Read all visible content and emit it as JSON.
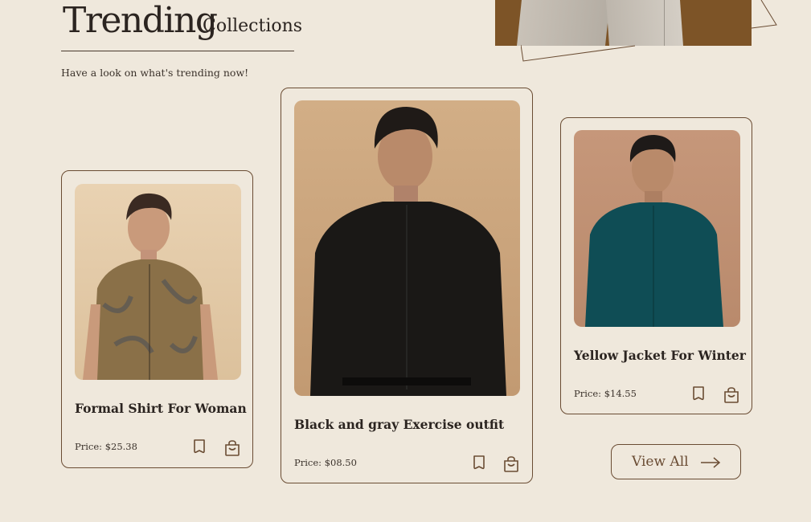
{
  "heading": {
    "title_main": "Trending",
    "title_sub": "Collections",
    "subtitle": "Have a look on what's trending now!"
  },
  "products": [
    {
      "name": "Formal Shirt For Woman",
      "price": "Price: $25.38",
      "shirt_color": "#8a7048"
    },
    {
      "name": "Black and gray Exercise outfit",
      "price": "Price: $08.50",
      "shirt_color": "#1a1816"
    },
    {
      "name": "Yellow Jacket For Winter",
      "price": "Price: $14.55",
      "shirt_color": "#0f4d55"
    }
  ],
  "view_all": {
    "label": "View All"
  },
  "colors": {
    "background": "#efe8dc",
    "border": "#6a4c33",
    "hero_bg": "#7d5427"
  }
}
